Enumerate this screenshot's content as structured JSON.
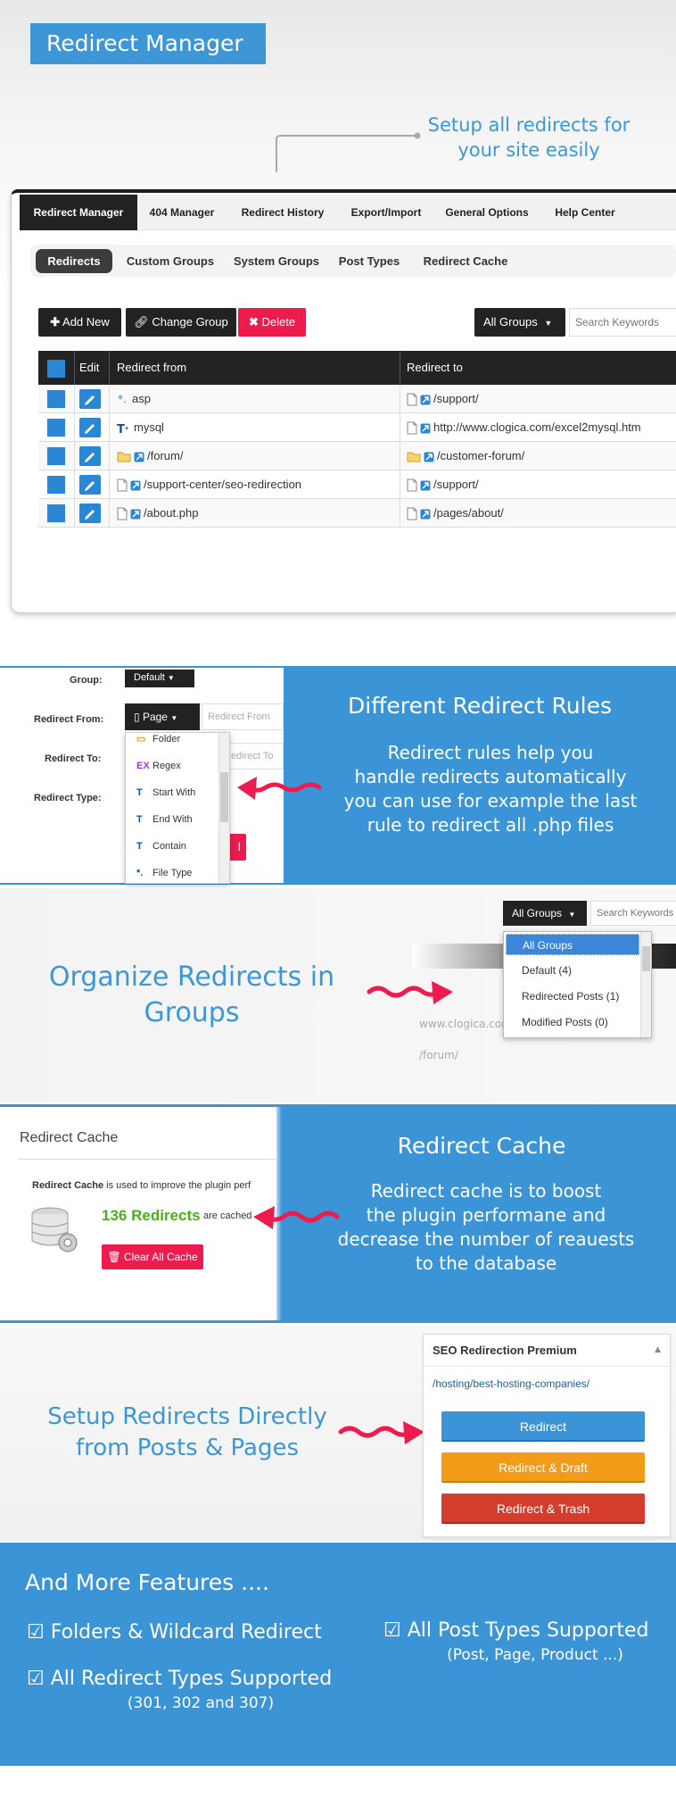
{
  "header": {
    "title": "Redirect Manager",
    "tagline_line1": "Setup all redirects for",
    "tagline_line2": "your site easily"
  },
  "main_tabs": [
    "Redirect Manager",
    "404 Manager",
    "Redirect History",
    "Export/Import",
    "General Options",
    "Help Center"
  ],
  "sub_tabs": [
    "Redirects",
    "Custom Groups",
    "System Groups",
    "Post Types",
    "Redirect Cache"
  ],
  "toolbar": {
    "add_new": "Add New",
    "change_group": "Change Group",
    "delete": "Delete",
    "groups_select": "All Groups",
    "search_placeholder": "Search Keywords"
  },
  "table": {
    "headers": {
      "edit": "Edit",
      "from": "Redirect from",
      "to": "Redirect to"
    },
    "rows": [
      {
        "from": "asp",
        "from_icon": "wildcard-icon",
        "to": "/support/",
        "to_icon": "page-icon"
      },
      {
        "from": "mysql",
        "from_icon": "start-with-icon",
        "to": "http://www.clogica.com/excel2mysql.htm",
        "to_icon": "page-icon"
      },
      {
        "from": "/forum/",
        "from_icon": "folder-icon",
        "to": "/customer-forum/",
        "to_icon": "folder-icon"
      },
      {
        "from": "/support-center/seo-redirection",
        "from_icon": "page-icon",
        "to": "/support/",
        "to_icon": "page-icon"
      },
      {
        "from": "/about.php",
        "from_icon": "page-icon",
        "to": "/pages/about/",
        "to_icon": "page-icon"
      }
    ]
  },
  "rules": {
    "labels": {
      "group": "Group:",
      "from": "Redirect From:",
      "to": "Redirect To:",
      "type": "Redirect Type:"
    },
    "group_value": "Default",
    "from_select": "Page",
    "from_placeholder": "Redirect From",
    "to_placeholder": "Redirect To",
    "menu": [
      "Folder",
      "Regex",
      "Start With",
      "End With",
      "Contain",
      "File Type"
    ],
    "title": "Different Redirect Rules",
    "text": [
      "Redirect rules help you",
      "handle redirects automatically",
      "you can use for example the last",
      "rule to redirect all .php files"
    ]
  },
  "groups": {
    "select": "All Groups",
    "search_placeholder": "Search Keywords",
    "options": [
      "All Groups",
      "Default (4)",
      "Redirected Posts (1)",
      "Modified Posts (0)"
    ],
    "bg_text_1": "www.clogica.com",
    "bg_text_2": "/forum/",
    "title_line1": "Organize Redirects in",
    "title_line2": "Groups"
  },
  "cache": {
    "panel_title": "Redirect Cache",
    "desc_bold": "Redirect Cache",
    "desc_rest": " is used to improve the plugin perf",
    "count": "136 Redirects",
    "count_suffix": "are cached",
    "clear_button": "Clear All Cache",
    "title": "Redirect Cache",
    "text": [
      "Redirect cache is to boost",
      "the plugin performane and",
      "decrease the number of reauests",
      "to the database"
    ]
  },
  "posts": {
    "title_line1": "Setup Redirects Directly",
    "title_line2": "from Posts & Pages",
    "widget_title": "SEO Redirection Premium",
    "widget_path": "/hosting/best-hosting-companies/",
    "buttons": [
      "Redirect",
      "Redirect & Draft",
      "Redirect & Trash"
    ]
  },
  "more": {
    "title": "And More Features ....",
    "items": [
      {
        "label": "Folders & Wildcard Redirect",
        "sub": ""
      },
      {
        "label": "All Post Types Supported",
        "sub": "(Post, Page, Product ...)"
      },
      {
        "label": "All Redirect Types Supported",
        "sub": "(301, 302 and 307)"
      }
    ]
  },
  "colors": {
    "accent": "#3b94d6",
    "delete": "#ee1c4e",
    "green": "#4cae1f",
    "orange": "#f39c1a",
    "red": "#d43c2c",
    "arrow": "#ee1c4e"
  }
}
